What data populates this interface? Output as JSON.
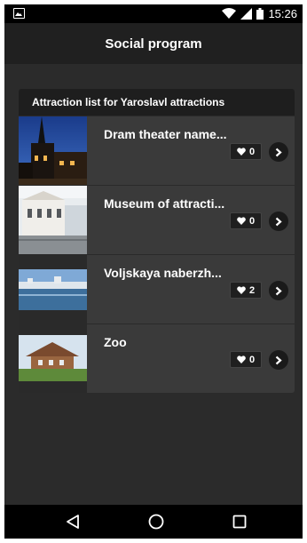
{
  "status_bar": {
    "time": "15:26",
    "icons": [
      "gallery-icon",
      "wifi-icon",
      "signal-icon",
      "battery-icon"
    ]
  },
  "app_bar": {
    "title": "Social program"
  },
  "list": {
    "header": "Attraction list for Yaroslavl attractions",
    "items": [
      {
        "name": "Dram theater name...",
        "likes": "0",
        "thumb": "night-theater-photo"
      },
      {
        "name": "Museum of attracti...",
        "likes": "0",
        "thumb": "museum-building-photo"
      },
      {
        "name": "Voljskaya naberzh...",
        "likes": "2",
        "thumb": "riverside-photo"
      },
      {
        "name": "Zoo",
        "likes": "0",
        "thumb": "zoo-house-photo"
      }
    ]
  },
  "nav_bar": {
    "buttons": [
      "back-icon",
      "home-icon",
      "recents-icon"
    ]
  },
  "colors": {
    "background": "#2b2b2b",
    "app_bar": "#202020",
    "card": "#3a3a3a",
    "card_header": "#1e1e1e"
  }
}
